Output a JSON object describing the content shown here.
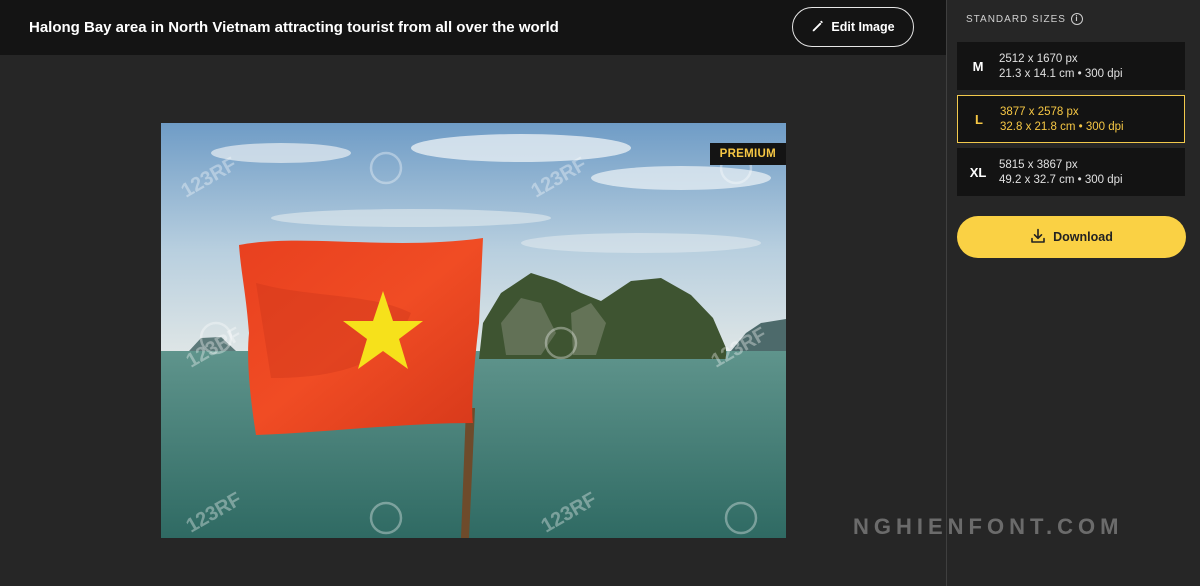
{
  "header": {
    "title": "Halong Bay area in North Vietnam attracting tourist from all over the world",
    "edit_label": "Edit Image"
  },
  "image": {
    "badge": "PREMIUM",
    "watermark": "123RF"
  },
  "panel": {
    "label": "STANDARD SIZES",
    "sizes": [
      {
        "letter": "M",
        "px": "2512 x 1670 px",
        "detail": "21.3 x 14.1 cm • 300 dpi",
        "selected": false
      },
      {
        "letter": "L",
        "px": "3877 x 2578 px",
        "detail": "32.8 x 21.8 cm • 300 dpi",
        "selected": true
      },
      {
        "letter": "XL",
        "px": "5815 x 3867 px",
        "detail": "49.2 x 32.7 cm • 300 dpi",
        "selected": false
      }
    ],
    "download_label": "Download"
  },
  "site_watermark": "NGHIENFONT.COM",
  "colors": {
    "accent": "#fad144",
    "selected_text": "#f6c744",
    "background": "#262626",
    "topbar": "#141414"
  },
  "icons": {
    "edit": "pencil-icon",
    "info": "info-icon",
    "download": "download-icon"
  }
}
